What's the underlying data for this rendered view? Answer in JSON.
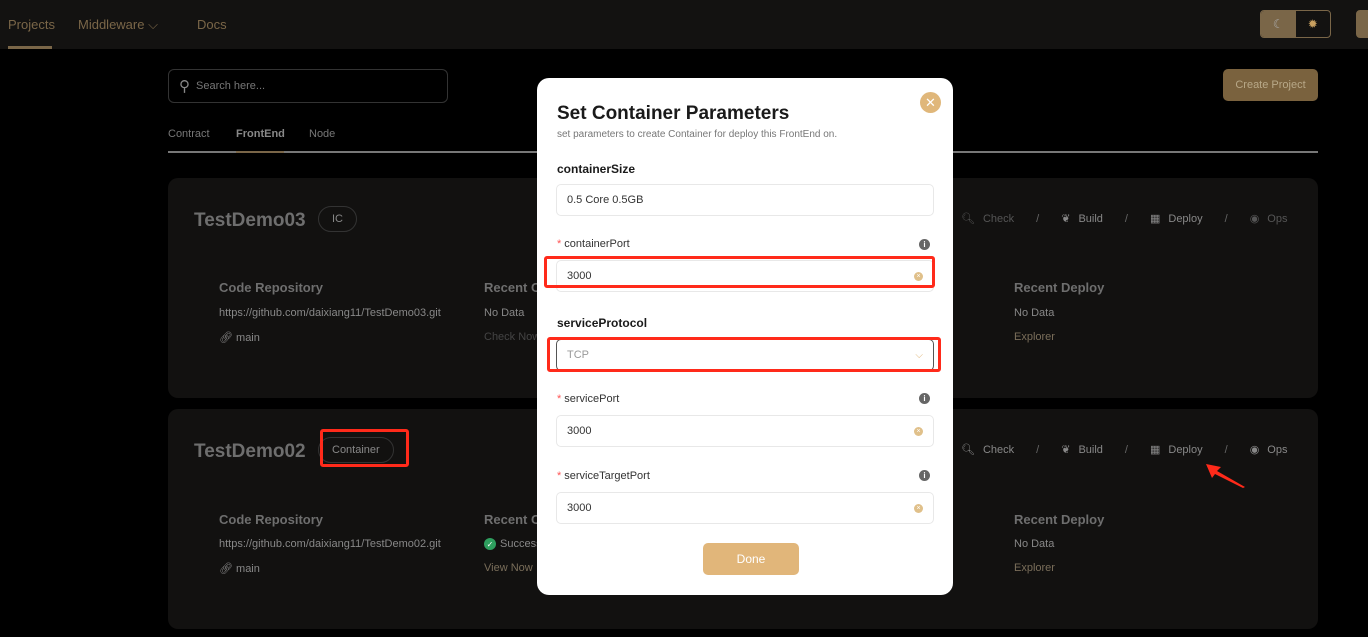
{
  "nav": {
    "items": [
      "Projects",
      "Middleware",
      "Docs"
    ],
    "active": "Projects"
  },
  "theme": {
    "dark_icon": "moon-icon",
    "light_icon": "sun-icon"
  },
  "search": {
    "placeholder": "Search here..."
  },
  "create_label": "Create Project",
  "tabs": [
    "Contract",
    "FrontEnd",
    "Node"
  ],
  "active_tab": "FrontEnd",
  "actions": [
    "Check",
    "Build",
    "Deploy",
    "Ops"
  ],
  "projects": [
    {
      "name": "TestDemo03",
      "badge": "IC",
      "repo_heading": "Code Repository",
      "repo": "https://github.com/daixiang11/TestDemo03.git",
      "branch": "main",
      "check_heading": "Recent C",
      "check_status": "No Data",
      "check_link": "Check Now",
      "deploy_heading": "Recent Deploy",
      "deploy_status": "No Data",
      "deploy_link": "Explorer"
    },
    {
      "name": "TestDemo02",
      "badge": "Container",
      "repo_heading": "Code Repository",
      "repo": "https://github.com/daixiang11/TestDemo02.git",
      "branch": "main",
      "check_heading": "Recent C",
      "check_status": "Success",
      "check_link": "View Now",
      "deploy_heading": "Recent Deploy",
      "deploy_status": "No Data",
      "deploy_link": "Explorer"
    }
  ],
  "modal": {
    "title": "Set Container Parameters",
    "subtitle": "set parameters to create Container for deploy this FrontEnd on.",
    "containerSize_label": "containerSize",
    "containerSize_value": "0.5 Core 0.5GB",
    "containerPort_label": "containerPort",
    "containerPort_value": "3000",
    "serviceProtocol_label": "serviceProtocol",
    "serviceProtocol_value": "TCP",
    "servicePort_label": "servicePort",
    "servicePort_value": "3000",
    "serviceTargetPort_label": "serviceTargetPort",
    "serviceTargetPort_value": "3000",
    "done_label": "Done"
  },
  "colors": {
    "accent": "#e1b67a",
    "nav_accent": "#7a6648",
    "annotation": "#ff2a1a",
    "success": "#2e9e5e"
  }
}
